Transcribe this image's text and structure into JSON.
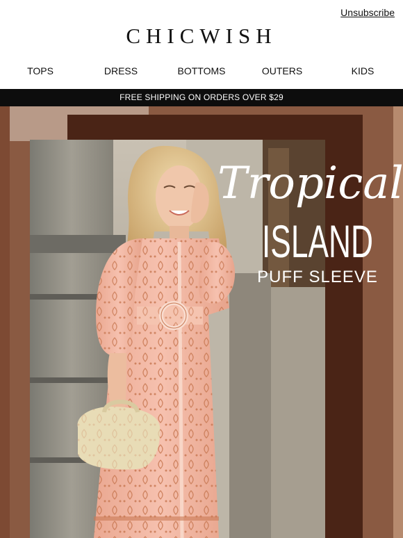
{
  "header": {
    "unsubscribe": "Unsubscribe",
    "brand": "CHICWISH"
  },
  "nav": {
    "items": [
      "TOPS",
      "DRESS",
      "BOTTOMS",
      "OUTERS",
      "KIDS"
    ]
  },
  "promo": {
    "shipping": "FREE SHIPPING ON ORDERS OVER $29"
  },
  "hero": {
    "line1": "Tropical",
    "line2": "ISLAND",
    "line3": "PUFF SLEEVE",
    "icon": "woman-in-puff-sleeve-dress-photo"
  },
  "colors": {
    "brown_dark": "#4a2416",
    "brown_mid": "#6e3b25",
    "dress": "#f2b5a2",
    "print": "#c97a55",
    "banner": "#0d0d0d"
  }
}
